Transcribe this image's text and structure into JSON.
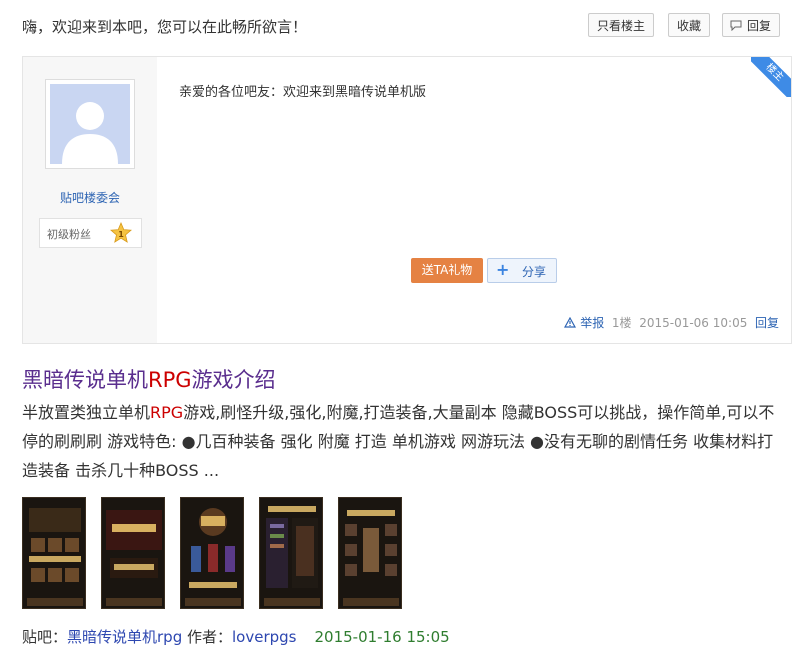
{
  "top": {
    "welcome": "嗨，欢迎来到本吧，您可以在此畅所欲言！",
    "only_owner": "只看楼主",
    "collect": "收藏",
    "reply": "回复"
  },
  "post": {
    "badge": "楼主",
    "username": "贴吧楼委会",
    "level_name": "初级粉丝",
    "level_num": "1",
    "content": "亲爱的各位吧友：欢迎来到黑暗传说单机版",
    "gift": "送TA礼物",
    "share": "分享",
    "report": "举报",
    "floor": "1楼",
    "time": "2015-01-06 10:05",
    "reply": "回复"
  },
  "result": {
    "title_a": "黑暗传说单机",
    "title_hl": "RPG",
    "title_b": "游戏介绍",
    "abstract_a": "半放置类独立单机",
    "abstract_hl": "RPG",
    "abstract_b": "游戏,刷怪升级,强化,附魔,打造装备,大量副本 隐藏BOSS可以挑战，操作简单,可以不停的刷刷刷 游戏特色: ●几百种装备 强化 附魔 打造 单机游戏 网游玩法 ●没有无聊的剧情任务 收集材料打造装备 击杀几十种BOSS ...",
    "bar_label": "贴吧：",
    "bar_name": "黑暗传说单机rpg",
    "author_label": " 作者：",
    "author": "loverpgs",
    "date": "2015-01-16 15:05"
  },
  "colors": {
    "link_blue": "#2d64b3",
    "title_purple": "#5a2e8e",
    "highlight_red": "#cc0000",
    "gift_orange": "#e58243",
    "date_green": "#2f7d2f"
  }
}
